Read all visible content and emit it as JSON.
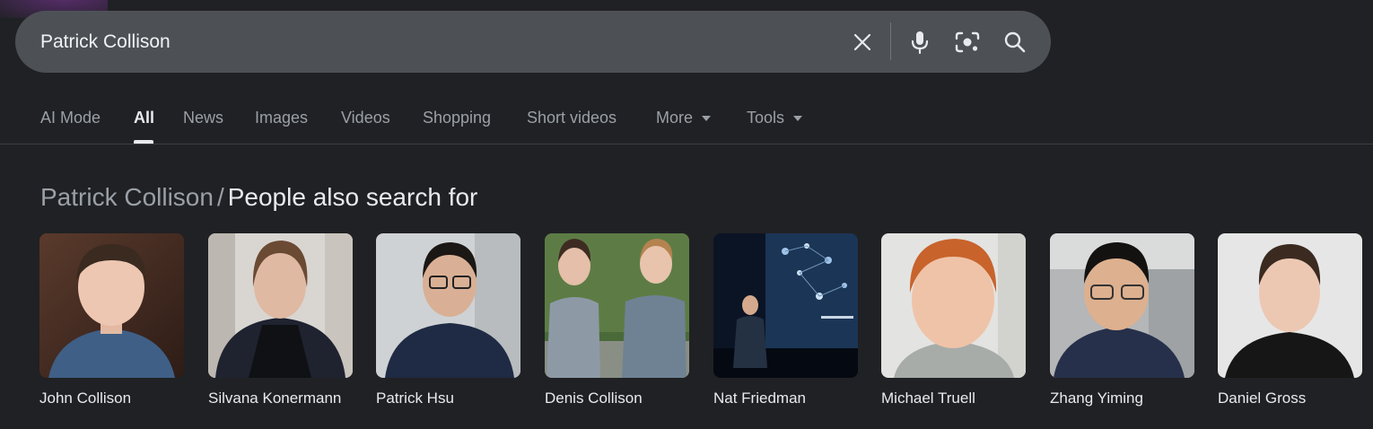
{
  "search": {
    "query": "Patrick Collison",
    "clear_icon": "close-icon",
    "voice_icon": "microphone-icon",
    "lens_icon": "camera-lens-icon",
    "search_icon": "search-icon"
  },
  "tabs": [
    {
      "label": "AI Mode"
    },
    {
      "label": "All",
      "active": true
    },
    {
      "label": "News"
    },
    {
      "label": "Images"
    },
    {
      "label": "Videos"
    },
    {
      "label": "Shopping"
    },
    {
      "label": "Short videos"
    },
    {
      "label": "More"
    },
    {
      "label": "Tools"
    }
  ],
  "section": {
    "breadcrumb": "Patrick Collison",
    "separator": "/",
    "title": "People also search for"
  },
  "people": [
    {
      "name": "John Collison"
    },
    {
      "name": "Silvana Konermann"
    },
    {
      "name": "Patrick Hsu"
    },
    {
      "name": "Denis Collison"
    },
    {
      "name": "Nat Friedman"
    },
    {
      "name": "Michael Truell"
    },
    {
      "name": "Zhang Yiming"
    },
    {
      "name": "Daniel Gross"
    }
  ],
  "colors": {
    "background": "#202124",
    "search_bar": "#4d5156",
    "text_primary": "#e8eaed",
    "text_secondary": "#9aa0a6"
  }
}
